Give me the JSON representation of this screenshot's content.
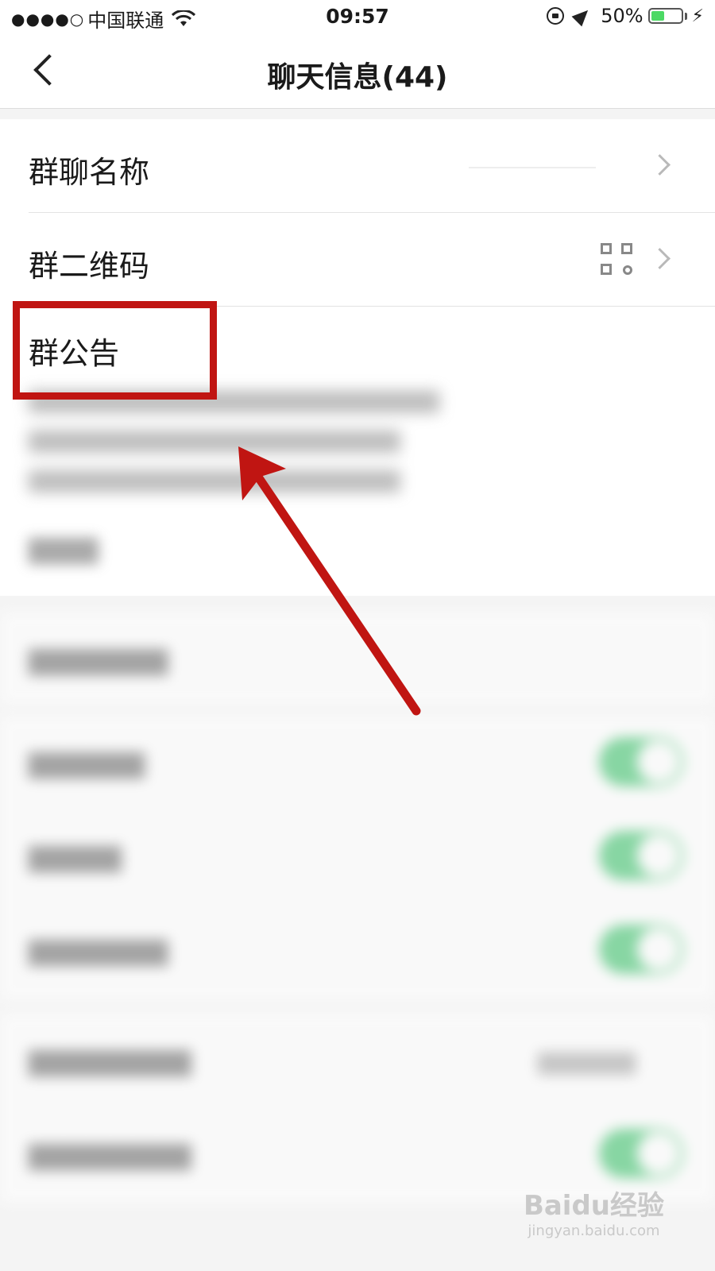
{
  "status_bar": {
    "signal": "●●●●○",
    "carrier": "中国联通",
    "time": "09:57",
    "battery": "50%",
    "battery_level": 0.5
  },
  "nav": {
    "title": "聊天信息(44)"
  },
  "group_info": {
    "name_label": "群聊名称",
    "qrcode_label": "群二维码",
    "notice_label": "群公告"
  },
  "colors": {
    "switch_on": "#1db954",
    "annotation_red": "#c01512"
  },
  "watermark": {
    "logo": "Baidu经验",
    "url": "jingyan.baidu.com"
  }
}
